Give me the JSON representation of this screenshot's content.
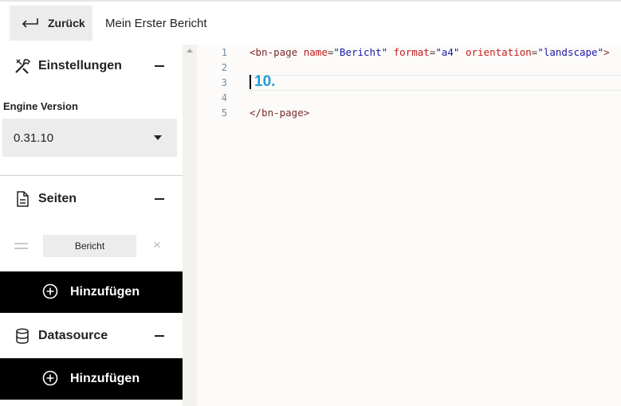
{
  "header": {
    "back_label": "Zurück",
    "report_title": "Mein Erster Bericht"
  },
  "sidebar": {
    "settings": {
      "title": "Einstellungen",
      "engine_label": "Engine Version",
      "engine_value": "0.31.10"
    },
    "pages": {
      "title": "Seiten",
      "items": [
        {
          "label": "Bericht"
        }
      ],
      "remove_symbol": "×",
      "add_label": "Hinzufügen"
    },
    "datasource": {
      "title": "Datasource",
      "add_label": "Hinzufügen"
    }
  },
  "editor": {
    "line_numbers": [
      "1",
      "2",
      "3",
      "4",
      "5"
    ],
    "line1": {
      "open": "<bn-page",
      "attr_name": "name",
      "name_value": "\"Bericht\"",
      "attr_format": "format",
      "format_value": "\"a4\"",
      "attr_orientation": "orientation",
      "orientation_value": "\"landscape\"",
      "close": ">",
      "eq": "="
    },
    "line5": "</bn-page>",
    "annotation": "10."
  }
}
